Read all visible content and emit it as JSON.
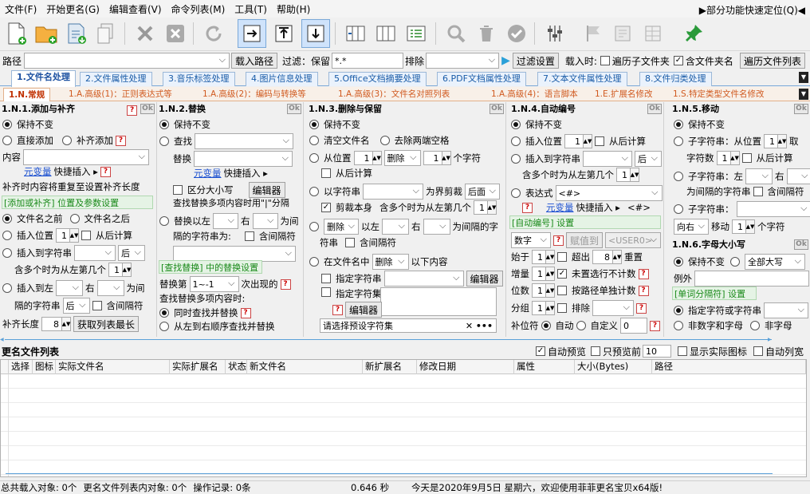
{
  "menu": {
    "items": [
      "文件(F)",
      "开始更名(G)",
      "编辑查看(V)",
      "命令列表(M)",
      "工具(T)",
      "帮助(H)"
    ],
    "quick": "▶部分功能快速定位(Q)◀"
  },
  "pathbar": {
    "path_label": "路径",
    "load_path": "载入路径",
    "filter_label": "过滤：保留",
    "filter_value": "*.*",
    "exclude_label": "排除",
    "filter_settings": "过滤设置",
    "load_time": "载入时:",
    "traverse_sub": "遍历子文件夹",
    "include_folder": "含文件夹名",
    "traverse_list": "遍历文件列表"
  },
  "tabs1": [
    "1.文件名处理",
    "2.文件属性处理",
    "3.音乐标签处理",
    "4.图片信息处理",
    "5.Office文档摘要处理",
    "6.PDF文档属性处理",
    "7.文本文件属性处理",
    "8.文件归类处理"
  ],
  "tabs2": [
    "1.N.常规",
    "1.A.高级(1)：正则表达式等",
    "1.A.高级(2)：编码与转换等",
    "1.A.高级(3)：文件名对照列表",
    "1.A.高级(4)：语言脚本",
    "1.E.扩展名修改",
    "1.S.特定类型文件名修改"
  ],
  "p1": {
    "title": "1.N.1.添加与补齐",
    "keep": "保持不变",
    "add_direct": "直接添加",
    "pad": "补齐添加",
    "content": "内容",
    "var_insert": "元变量",
    "quick_insert": "快捷插入 ▸",
    "pad_note": "补齐时内容将重复至设置补齐长度",
    "sect": "[添加或补齐] 位置及参数设置",
    "before": "文件名之前",
    "after": "文件名之后",
    "insert_pos": "插入位置",
    "from_back": "从后计算",
    "insert_to_str": "插入到字符串",
    "after_opt": "后",
    "multi_note": "含多个时为从左第几个",
    "insert_left": "插入到左",
    "right": "右",
    "between": "为间",
    "sep_str": "隔的字符串",
    "contain_sep": "含间隔符",
    "pad_len": "补齐长度",
    "pad_len_val": "8",
    "fetch_max": "获取列表最长",
    "one": "1"
  },
  "p2": {
    "title": "1.N.2.替换",
    "keep": "保持不变",
    "find": "查找",
    "replace": "替换",
    "var_insert": "元变量",
    "quick_insert": "快捷插入 ▸",
    "case": "区分大小写",
    "editor": "编辑器",
    "multi_note": "查找替换多项内容时用\"|\"分隔",
    "replace_lr": "替换以左",
    "right": "右",
    "between": "为间",
    "sep_str": "隔的字符串为:",
    "contain_sep": "含间隔符",
    "sect": "[查找替换] 中的替换设置",
    "nth_label": "替换第",
    "nth_val": "1~-1",
    "nth_suffix": "次出现的",
    "multi_mode": "查找替换多项内容时:",
    "simul": "同时查找并替换",
    "seq": "从左到右顺序查找并替换"
  },
  "p3": {
    "title": "1.N.3.删除与保留",
    "keep": "保持不变",
    "clear": "清空文件名",
    "trim": "去除两端空格",
    "from_pos": "从位置",
    "delete": "删除",
    "chars": "个字符",
    "from_back": "从后计算",
    "by_str": "以字符串",
    "as_bound": "为界剪裁",
    "back": "后面",
    "clip_self": "剪裁本身",
    "multi_note": "含多个时为从左第几个",
    "del2": "删除",
    "left": "以左",
    "right": "右",
    "between": "为间隔的字",
    "str": "符串",
    "contain_sep": "含间隔符",
    "in_name": "在文件名中",
    "del3": "删除",
    "below": "以下内容",
    "spec_str": "指定字符串",
    "editor": "编辑器",
    "spec_set": "指定字符集",
    "editor2": "编辑器",
    "preset": "请选择预设字符集",
    "one": "1"
  },
  "p4": {
    "title": "1.N.4.自动编号",
    "keep": "保持不变",
    "insert_pos": "插入位置",
    "from_back": "从后计算",
    "insert_to_str": "插入到字符串",
    "after_opt": "后",
    "multi_note": "含多个时为从左第几个",
    "expr": "表达式",
    "expr_val": "<#>",
    "var_insert": "元变量",
    "quick_insert": "快捷插入 ▸",
    "expr_tag": "<#>",
    "sect": "[自动编号] 设置",
    "num_type": "数字",
    "fill_to": "赋值到",
    "user0": "<USER0>",
    "start": "始于",
    "overflow": "超出",
    "overflow_val": "8",
    "reset": "重置",
    "step": "增量",
    "skip": "未置选行不计数",
    "digits": "位数",
    "by_path": "按路径单独计数",
    "group": "分组",
    "exclude": "排除",
    "pad_pos": "补位符",
    "auto": "自动",
    "custom": "自定义",
    "custom_val": "0",
    "one": "1"
  },
  "p5": {
    "title": "1.N.5.移动",
    "keep": "保持不变",
    "sub_from": "子字符串：从位置",
    "take": "取",
    "chars": "字符数",
    "from_back": "从后计算",
    "sub_left": "子字符串：左",
    "right": "右",
    "sep_note": "为间隔的字符串",
    "contain_sep": "含间隔符",
    "sub": "子字符串：",
    "dir": "向右",
    "move": "移动",
    "move_chars": "个字符",
    "one": "1"
  },
  "p6": {
    "title": "1.N.6.字母大小写",
    "keep": "保持不变",
    "all_upper": "全部大写",
    "exception": "例外",
    "sect": "[单词分隔符] 设置",
    "spec": "指定字符或字符串",
    "nonalnum": "非数字和字母",
    "nonletter": "非字母"
  },
  "list": {
    "title": "更名文件列表",
    "auto_preview": "自动预览",
    "preview_only": "只预览前",
    "preview_n": "10",
    "show_icon": "显示实际图标",
    "auto_width": "自动列宽",
    "cols": [
      "选择",
      "图标",
      "实际文件名",
      "实际扩展名",
      "状态",
      "新文件名",
      "新扩展名",
      "修改日期",
      "属性",
      "大小(Bytes)",
      "路径"
    ]
  },
  "status": {
    "total": "总共载入对象: 0个",
    "in_list": "更名文件列表内对象: 0个",
    "ops": "操作记录: 0条",
    "time": "0.646 秒",
    "today": "今天是2020年9月5日 星期六，欢迎使用菲菲更名宝贝x64版!"
  },
  "ok": "Ok",
  "q": "?"
}
